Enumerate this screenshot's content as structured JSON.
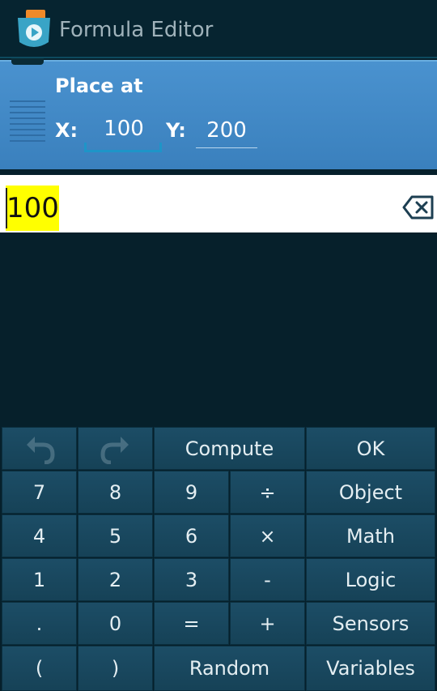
{
  "actionbar": {
    "title": "Formula Editor"
  },
  "brick": {
    "title": "Place at",
    "x_label": "X:",
    "x_value": "100",
    "y_label": "Y:",
    "y_value": "200"
  },
  "formula": {
    "text": "100"
  },
  "keyboard": {
    "compute": "Compute",
    "ok": "OK",
    "k7": "7",
    "k8": "8",
    "k9": "9",
    "divide": "÷",
    "object": "Object",
    "k4": "4",
    "k5": "5",
    "k6": "6",
    "multiply": "×",
    "math": "Math",
    "k1": "1",
    "k2": "2",
    "k3": "3",
    "minus": "-",
    "logic": "Logic",
    "dot": ".",
    "k0": "0",
    "equals": "=",
    "plus": "+",
    "sensors": "Sensors",
    "lparen": "(",
    "rparen": ")",
    "random": "Random",
    "variables": "Variables"
  },
  "icons": {
    "app": "pocket-code-app-icon",
    "backspace": "backspace-icon",
    "undo": "undo-icon",
    "redo": "redo-icon"
  },
  "colors": {
    "brick": "#4a92cf",
    "key": "#1c4d66",
    "highlight": "#ffff00",
    "accent": "#1e95c8"
  }
}
